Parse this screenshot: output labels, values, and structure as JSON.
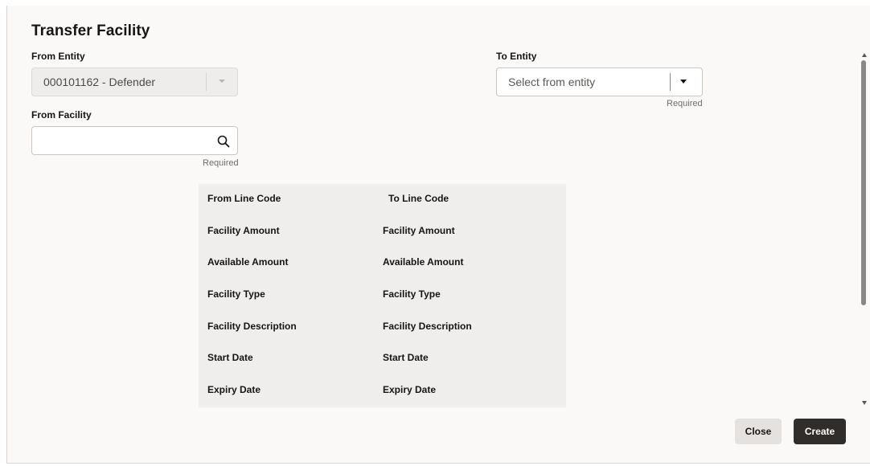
{
  "dialog": {
    "title": "Transfer Facility"
  },
  "from_entity": {
    "label": "From Entity",
    "value": "000101162 - Defender"
  },
  "to_entity": {
    "label": "To Entity",
    "placeholder": "Select from entity",
    "required_text": "Required"
  },
  "from_facility": {
    "label": "From Facility",
    "value": "",
    "required_text": "Required"
  },
  "details": {
    "from_column": [
      "From Line Code",
      "Facility Amount",
      "Available Amount",
      "Facility Type",
      "Facility Description",
      "Start Date",
      "Expiry Date"
    ],
    "to_column": [
      "To Line Code",
      "Facility Amount",
      "Available Amount",
      "Facility Type",
      "Facility Description",
      "Start Date",
      "Expiry Date"
    ]
  },
  "footer": {
    "close_label": "Close",
    "create_label": "Create"
  }
}
